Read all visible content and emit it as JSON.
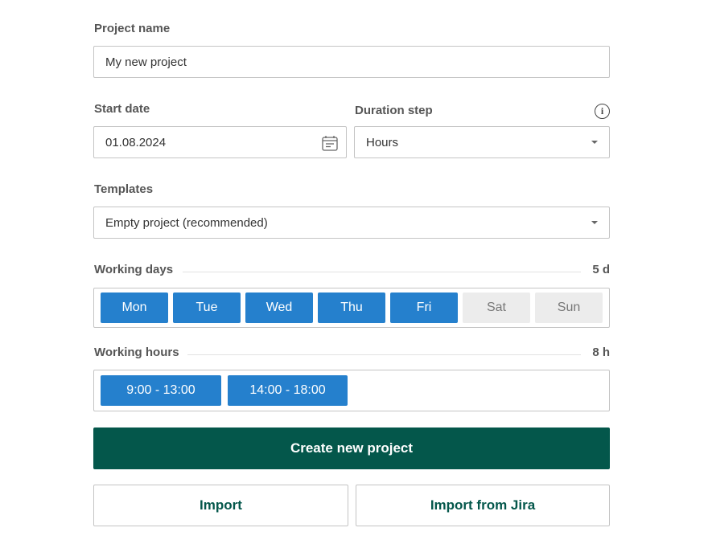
{
  "project_name": {
    "label": "Project name",
    "value": "My new project"
  },
  "start_date": {
    "label": "Start date",
    "value": "01.08.2024"
  },
  "duration_step": {
    "label": "Duration step",
    "value": "Hours"
  },
  "templates": {
    "label": "Templates",
    "value": "Empty project (recommended)"
  },
  "working_days": {
    "label": "Working days",
    "total": "5 d",
    "days": [
      {
        "label": "Mon",
        "active": true
      },
      {
        "label": "Tue",
        "active": true
      },
      {
        "label": "Wed",
        "active": true
      },
      {
        "label": "Thu",
        "active": true
      },
      {
        "label": "Fri",
        "active": true
      },
      {
        "label": "Sat",
        "active": false
      },
      {
        "label": "Sun",
        "active": false
      }
    ]
  },
  "working_hours": {
    "label": "Working hours",
    "total": "8 h",
    "ranges": [
      "9:00 - 13:00",
      "14:00 - 18:00"
    ]
  },
  "actions": {
    "create": "Create new project",
    "import": "Import",
    "import_jira": "Import from Jira"
  },
  "colors": {
    "accent": "#2580cd",
    "primary": "#04574b"
  }
}
